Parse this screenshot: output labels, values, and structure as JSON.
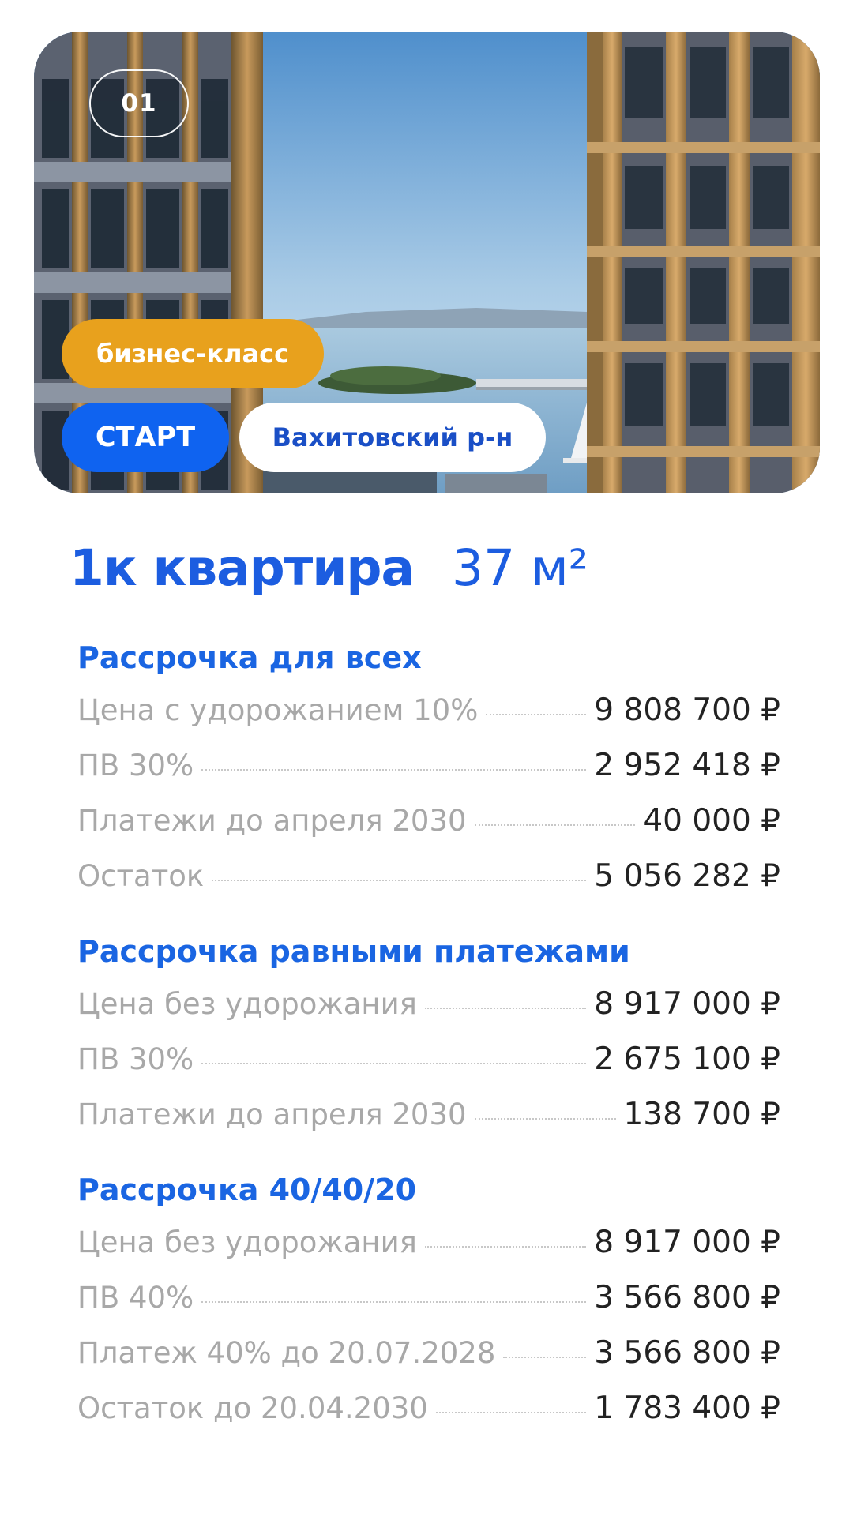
{
  "hero": {
    "number": "01",
    "tags": {
      "class_label": "бизнес-класс",
      "status_label": "СТАРТ",
      "district_label": "Вахитовский р-н"
    }
  },
  "title": {
    "apartment": "1к квартира",
    "area": "37 м²"
  },
  "colors": {
    "accent_blue": "#1c5de0",
    "start_chip": "#0f63f0",
    "class_chip": "#e8a11d",
    "label_gray": "#a8a8a8"
  },
  "sections": [
    {
      "title": "Рассрочка для всех",
      "rows": [
        {
          "label": "Цена с удорожанием 10%",
          "value": "9 808 700 ₽"
        },
        {
          "label": "ПВ 30%",
          "value": "2 952 418 ₽"
        },
        {
          "label": "Платежи до апреля 2030",
          "value": "40 000 ₽"
        },
        {
          "label": "Остаток",
          "value": "5 056 282 ₽"
        }
      ]
    },
    {
      "title": "Рассрочка равными платежами",
      "rows": [
        {
          "label": "Цена без удорожания",
          "value": "8 917 000 ₽"
        },
        {
          "label": "ПВ 30%",
          "value": "2 675 100 ₽"
        },
        {
          "label": "Платежи до апреля 2030",
          "value": "138 700 ₽"
        }
      ]
    },
    {
      "title": "Рассрочка 40/40/20",
      "rows": [
        {
          "label": "Цена без удорожания",
          "value": "8 917 000 ₽"
        },
        {
          "label": "ПВ 40%",
          "value": "3 566 800 ₽"
        },
        {
          "label": "Платеж 40% до 20.07.2028",
          "value": "3 566 800 ₽"
        },
        {
          "label": "Остаток до 20.04.2030",
          "value": "1 783 400 ₽"
        }
      ]
    }
  ]
}
